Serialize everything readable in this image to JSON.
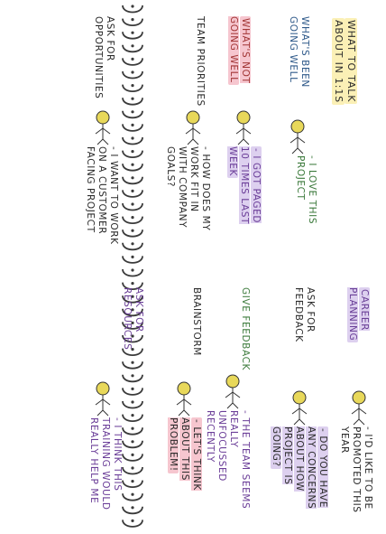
{
  "title": {
    "line1": "What to talk",
    "line2": "about in 1:1s"
  },
  "top_half": {
    "rows": [
      {
        "label": "What's been going well",
        "quote": "- I love this project"
      },
      {
        "label": "What's not going well",
        "quote": "- I got paged 10 times last week"
      },
      {
        "label": "Team priorities",
        "quote": "- How does my work fit in with company goals?"
      },
      {
        "label": "Ask for opportunities",
        "quote": "- I want to work on a customer facing project"
      }
    ]
  },
  "bottom_half": {
    "rows": [
      {
        "label": "Career planning",
        "quote": "- I'd like to be promoted this year"
      },
      {
        "label": "Ask for feedback",
        "quote": "- Do you have any concerns about how project is going?"
      },
      {
        "label": "Give feedback",
        "quote": "- The team seems really unfocussed recently"
      },
      {
        "label": "Brainstorm",
        "quote": "- Let's think about this problem!"
      },
      {
        "label": "Ask for resources",
        "quote": "- I think this training would really help me"
      }
    ]
  },
  "colors": {
    "pink": "#f6c6cf",
    "green": "#cfe9cf",
    "purple": "#ddd0ef",
    "yellow": "#fbf0b6",
    "spiral": "#3a3a3a"
  }
}
